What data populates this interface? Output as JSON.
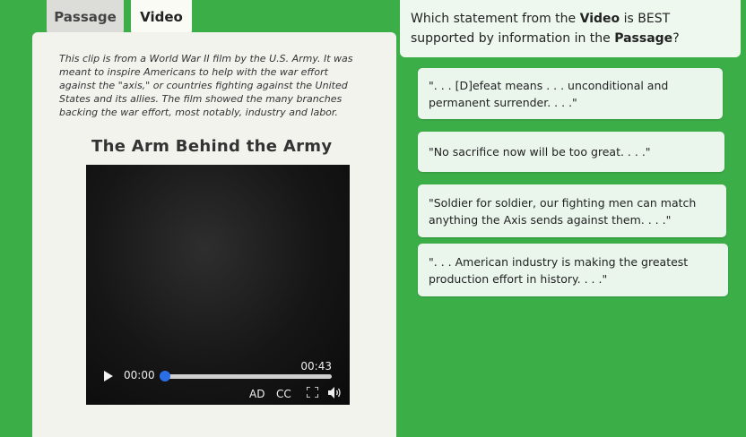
{
  "tabs": {
    "passage": "Passage",
    "video": "Video"
  },
  "passage": {
    "intro": "This clip is from a World War II film by the U.S. Army. It was meant to inspire Americans to help with the war effort against the \"axis,\" or countries fighting against the United States and its allies. The film showed the many branches backing the war effort, most notably, industry and labor.",
    "video_title": "The Arm Behind the Army"
  },
  "player": {
    "current_time": "00:00",
    "duration": "00:43",
    "progress": 0,
    "ad_label": "AD",
    "cc_label": "CC"
  },
  "question": {
    "part1": "Which statement from the ",
    "bold1": "Video",
    "part2": " is BEST supported by information in the ",
    "bold2": "Passage",
    "part3": "?"
  },
  "answers": [
    "\". . . [D]efeat means . . . unconditional and permanent surrender. . . .\"",
    "\"No sacrifice now will be too great. . . .\"",
    "\"Soldier for soldier, our fighting men can match anything the Axis sends against them. . . .\"",
    "\". . . American industry is making the greatest production effort in history. . . .\""
  ],
  "colors": {
    "background": "#3cae48",
    "answer_bg": "#eaf6ec",
    "seek_accent": "#2b6ee8"
  }
}
